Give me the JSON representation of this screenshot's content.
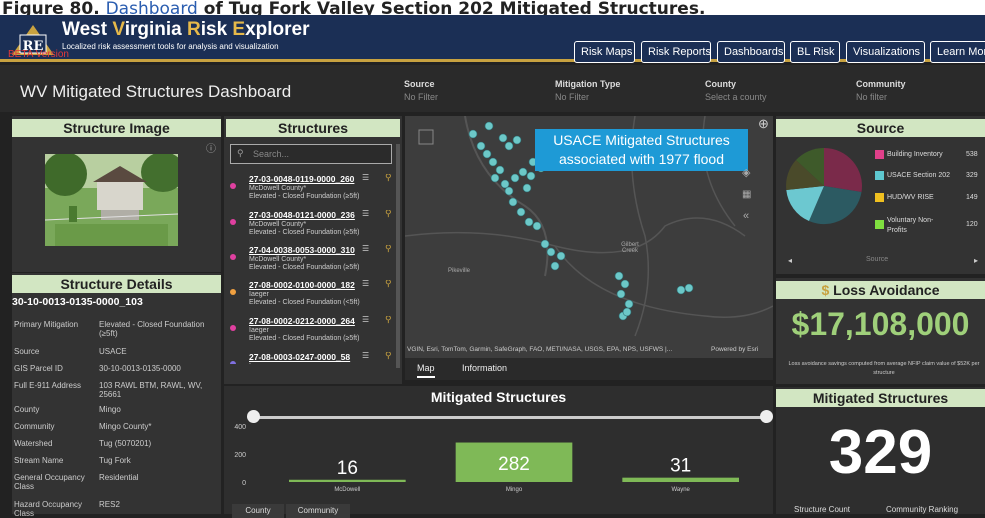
{
  "caption": {
    "prefix": "Figure 80.",
    "link": "Dashboard",
    "suffix": "of Tug Fork Valley Section 202 Mitigated Structures."
  },
  "app": {
    "title_part1": "West ",
    "title_part2": "V",
    "title_part3": "irginia ",
    "title_part4": "R",
    "title_part5": "isk ",
    "title_part6": "E",
    "title_part7": "xplorer",
    "subtitle": "Localized risk assessment tools for analysis and visualization",
    "beta": "BETA Version"
  },
  "nav": [
    "Risk Maps",
    "Risk Reports",
    "Dashboards",
    "BL Risk",
    "Visualizations",
    "Learn More"
  ],
  "dashboard_title": "WV Mitigated Structures Dashboard",
  "filters": [
    {
      "label": "Source",
      "value": "No Filter"
    },
    {
      "label": "Mitigation Type",
      "value": "No Filter"
    },
    {
      "label": "County",
      "value": "Select a county"
    },
    {
      "label": "Community",
      "value": "No filter"
    }
  ],
  "structure_image": {
    "title": "Structure Image"
  },
  "structure_details": {
    "title": "Structure Details",
    "id": "30-10-0013-0135-0000_103",
    "rows": [
      {
        "k": "Primary Mitigation",
        "v": "Elevated - Closed Foundation (≥5ft)"
      },
      {
        "k": "Source",
        "v": "USACE"
      },
      {
        "k": "GIS Parcel ID",
        "v": "30-10-0013-0135-0000"
      },
      {
        "k": "Full E-911 Address",
        "v": "103 RAWL BTM, RAWL, WV, 25661"
      },
      {
        "k": "County",
        "v": "Mingo"
      },
      {
        "k": "Community",
        "v": "Mingo County*"
      },
      {
        "k": "Watershed",
        "v": "Tug (5070201)"
      },
      {
        "k": "Stream Name",
        "v": "Tug Fork"
      },
      {
        "k": "General Occupancy Class",
        "v": "Residential"
      },
      {
        "k": "Hazard Occupancy Class",
        "v": "RES2"
      }
    ]
  },
  "structures": {
    "title": "Structures",
    "search_placeholder": "Search...",
    "items": [
      {
        "name": "27-03-0048-0119-0000_260",
        "county": "McDowell County*",
        "type": "Elevated - Closed Foundation (≥5ft)",
        "color": "#e040a0"
      },
      {
        "name": "27-03-0048-0121-0000_236",
        "county": "McDowell County*",
        "type": "Elevated - Closed Foundation (≥5ft)",
        "color": "#e040a0"
      },
      {
        "name": "27-04-0038-0053-0000_310",
        "county": "McDowell County*",
        "type": "Elevated - Closed Foundation (≥5ft)",
        "color": "#e040a0"
      },
      {
        "name": "27-08-0002-0100-0000_182",
        "county": "Iaeger",
        "type": "Elevated - Closed Foundation (<5ft)",
        "color": "#f0a040"
      },
      {
        "name": "27-08-0002-0212-0000_264",
        "county": "Iaeger",
        "type": "Elevated - Closed Foundation (≥5ft)",
        "color": "#e040a0"
      },
      {
        "name": "27-08-0003-0247-0000_58",
        "county": "Iaeger",
        "type": "",
        "color": "#8070e0"
      }
    ]
  },
  "map": {
    "callout": "USACE Mitigated Structures associated with 1977 flood",
    "place1": "Pikeville",
    "place2": "Gilbert Creek",
    "attribution": "VGIN, Esri, TomTom, Garmin, SafeGraph, FAO, METI/NASA, USGS, EPA, NPS, USFWS |...",
    "powered": "Powered by Esri",
    "tabs": [
      "Map",
      "Information"
    ]
  },
  "source": {
    "title": "Source",
    "footer": "Source",
    "legend": [
      {
        "label": "Building Inventory",
        "count": "538",
        "color": "#e0408a"
      },
      {
        "label": "USACE Section 202",
        "count": "329",
        "color": "#5ec8d0"
      },
      {
        "label": "HUD/WV RISE",
        "count": "149",
        "color": "#f0c020"
      },
      {
        "label": "Voluntary Non-Profits",
        "count": "120",
        "color": "#80e040"
      }
    ]
  },
  "loss": {
    "title": "Loss Avoidance",
    "value": "$17,108,000",
    "note": "Loss avoidance savings computed from average NFIP claim value of $52K per structure"
  },
  "mitigated_card": {
    "title": "Mitigated Structures",
    "value": "329",
    "tabs": [
      "Structure Count",
      "Community Ranking"
    ]
  },
  "bar_tabs": [
    "County",
    "Community"
  ],
  "chart_data": {
    "type": "bar",
    "title": "Mitigated Structures",
    "categories": [
      "McDowell",
      "Mingo",
      "Wayne"
    ],
    "values": [
      16,
      282,
      31
    ],
    "yticks": [
      0,
      200,
      400
    ],
    "ylim": [
      0,
      400
    ],
    "color": "#7fb957"
  }
}
